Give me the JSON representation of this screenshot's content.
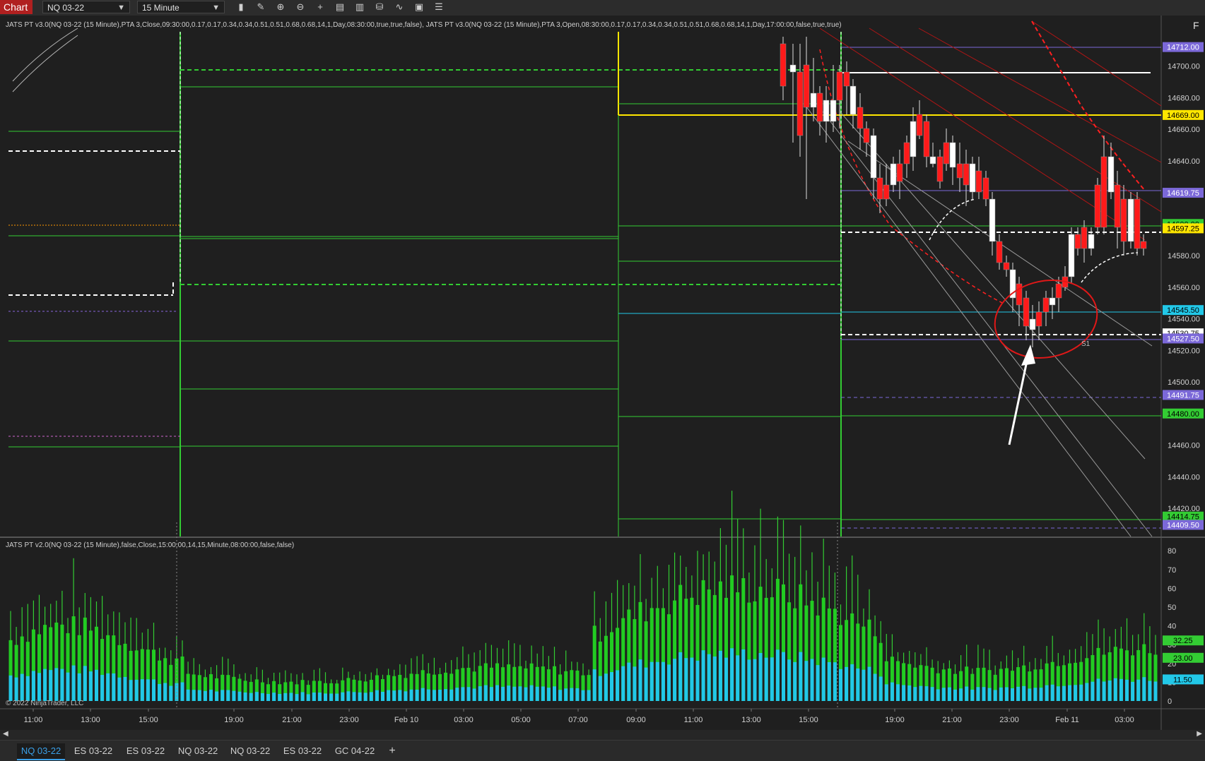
{
  "toolbar": {
    "chart_label": "Chart",
    "instrument": "NQ 03-22",
    "interval": "15 Minute",
    "icons": [
      "bar-type-icon",
      "pencil-icon",
      "zoom-in-icon",
      "zoom-out-icon",
      "crosshair-icon",
      "properties-icon",
      "template-icon",
      "strategies-icon",
      "indicators-icon",
      "snapshot-icon",
      "data-box-icon"
    ]
  },
  "price_panel": {
    "indicator_label": "JATS PT v3.0(NQ 03-22 (15 Minute),PTA 3,Close,09:30:00,0.17,0.17,0.34,0.34,0.51,0.51,0.68,0.68,14,1,Day,08:30:00,true,true,false), JATS PT v3.0(NQ 03-22 (15 Minute),PTA 3,Open,08:30:00,0.17,0.17,0.34,0.34,0.51,0.51,0.68,0.68,14,1,Day,17:00:00,false,true,true)",
    "corner_label": "F",
    "axis_ticks": [
      "14700.00",
      "14680.00",
      "14660.00",
      "14640.00",
      "14620.00",
      "14600.00",
      "14580.00",
      "14560.00",
      "14540.00",
      "14520.00",
      "14500.00",
      "14480.00",
      "14460.00",
      "14440.00",
      "14420.00"
    ],
    "price_tags": [
      {
        "text": "14712.00",
        "bg": "#7b68d8",
        "fg": "#ffffff"
      },
      {
        "text": "14669.00",
        "bg": "#ffe600",
        "fg": "#000000"
      },
      {
        "text": "14619.75",
        "bg": "#7b68d8",
        "fg": "#ffffff"
      },
      {
        "text": "14600.00",
        "bg": "#33cc33",
        "fg": "#000000"
      },
      {
        "text": "14597.25",
        "bg": "#ffe600",
        "fg": "#000000"
      },
      {
        "text": "14545.50",
        "bg": "#22c8e8",
        "fg": "#000000"
      },
      {
        "text": "14530.75",
        "bg": "#ffffff",
        "fg": "#000000"
      },
      {
        "text": "14527.50",
        "bg": "#7b68d8",
        "fg": "#ffffff"
      },
      {
        "text": "14491.75",
        "bg": "#7b68d8",
        "fg": "#ffffff"
      },
      {
        "text": "14480.00",
        "bg": "#33cc33",
        "fg": "#000000"
      },
      {
        "text": "14414.75",
        "bg": "#33cc33",
        "fg": "#000000"
      },
      {
        "text": "14409.50",
        "bg": "#7b68d8",
        "fg": "#ffffff"
      }
    ],
    "level_label_s1": "S1"
  },
  "volume_panel": {
    "indicator_label": "JATS PT v2.0(NQ 03-22 (15 Minute),false,Close,15:00:00,14,15,Minute,08:00:00,false,false)",
    "axis_ticks": [
      "80",
      "70",
      "60",
      "50",
      "40",
      "30",
      "20",
      "10",
      "0"
    ],
    "value_tags": [
      {
        "text": "32.25",
        "bg": "#33cc33",
        "fg": "#000000"
      },
      {
        "text": "23.00",
        "bg": "#33cc33",
        "fg": "#000000"
      },
      {
        "text": "11.50",
        "bg": "#22c8e8",
        "fg": "#000000"
      }
    ],
    "copyright": "© 2022 NinjaTrader, LLC"
  },
  "time_axis": [
    "11:00",
    "13:00",
    "15:00",
    "19:00",
    "21:00",
    "23:00",
    "Feb 10",
    "03:00",
    "05:00",
    "07:00",
    "09:00",
    "11:00",
    "13:00",
    "15:00",
    "19:00",
    "21:00",
    "23:00",
    "Feb 11",
    "03:00"
  ],
  "tabs": [
    "NQ 03-22",
    "ES 03-22",
    "ES 03-22",
    "NQ 03-22",
    "NQ 03-22",
    "ES 03-22",
    "GC 04-22"
  ],
  "add_tab_label": "+",
  "colors": {
    "background": "#1f1f1f",
    "bull": "#ffffff",
    "bear": "#ff1a1a",
    "green": "#33cc33",
    "cyan": "#22c8e8",
    "yellow": "#ffe600",
    "purple": "#7b68d8"
  }
}
